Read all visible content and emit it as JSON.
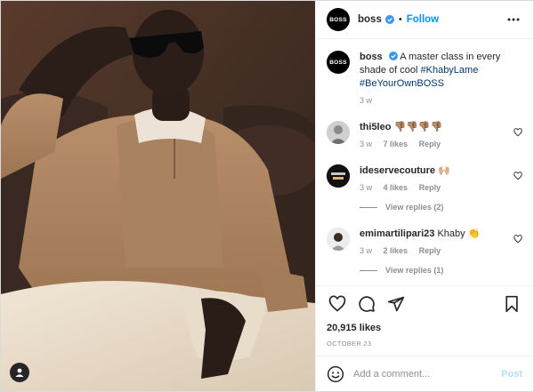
{
  "post": {
    "author": "boss",
    "follow_label": "Follow",
    "dot": "•",
    "avatar_text": "BOSS",
    "caption": {
      "text": "A master class in every shade of cool",
      "hashtags": [
        "#KhabyLame",
        "#BeYourOwnBOSS"
      ],
      "time": "3 w"
    },
    "comments": [
      {
        "username": "thi5leo",
        "text": "👎🏽👎🏽👎🏽👎🏽",
        "time": "3 w",
        "likes": "7 likes",
        "reply_label": "Reply",
        "view_replies": null
      },
      {
        "username": "ideservecouture",
        "text": "🙌🏼",
        "time": "3 w",
        "likes": "4 likes",
        "reply_label": "Reply",
        "view_replies": "View replies (2)"
      },
      {
        "username": "emimartilipari23",
        "text": "Khaby 👏",
        "time": "3 w",
        "likes": "2 likes",
        "reply_label": "Reply",
        "view_replies": "View replies (1)"
      }
    ],
    "like_count": "20,915 likes",
    "date": "OCTOBER 23",
    "add_comment_placeholder": "Add a comment...",
    "post_button": "Post"
  },
  "icons": [
    "more-icon",
    "verified-icon",
    "heart-icon",
    "comment-icon",
    "share-icon",
    "bookmark-icon",
    "emoji-icon",
    "user-tag-icon"
  ],
  "colors": {
    "accent": "#0095f6",
    "verified": "#3897f0",
    "hashtag": "#00376b",
    "muted": "#8e8e8e",
    "post_disabled": "#b2dffc"
  }
}
